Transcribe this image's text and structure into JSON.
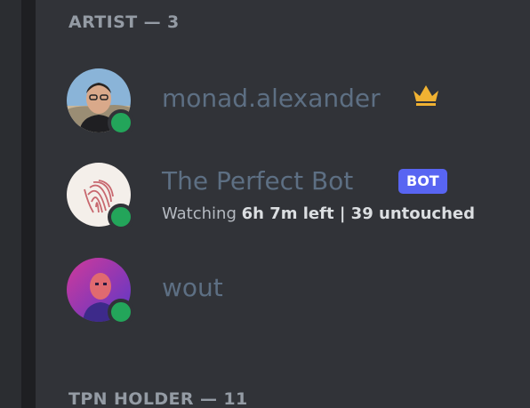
{
  "sections": [
    {
      "title": "ARTIST — 3"
    },
    {
      "title": "TPN HOLDER — 11"
    }
  ],
  "members": [
    {
      "name": "monad.alexander",
      "status": "online",
      "badge_icon": "crown-icon"
    },
    {
      "name": "The Perfect Bot",
      "status": "online",
      "tag": "BOT",
      "activity": {
        "verb": "Watching",
        "detail": "6h 7m left | 39 untouched"
      }
    },
    {
      "name": "wout",
      "status": "online"
    }
  ],
  "colors": {
    "online": "#23a55a",
    "bot_tag": "#5865f2",
    "crown": "#f0b232"
  }
}
